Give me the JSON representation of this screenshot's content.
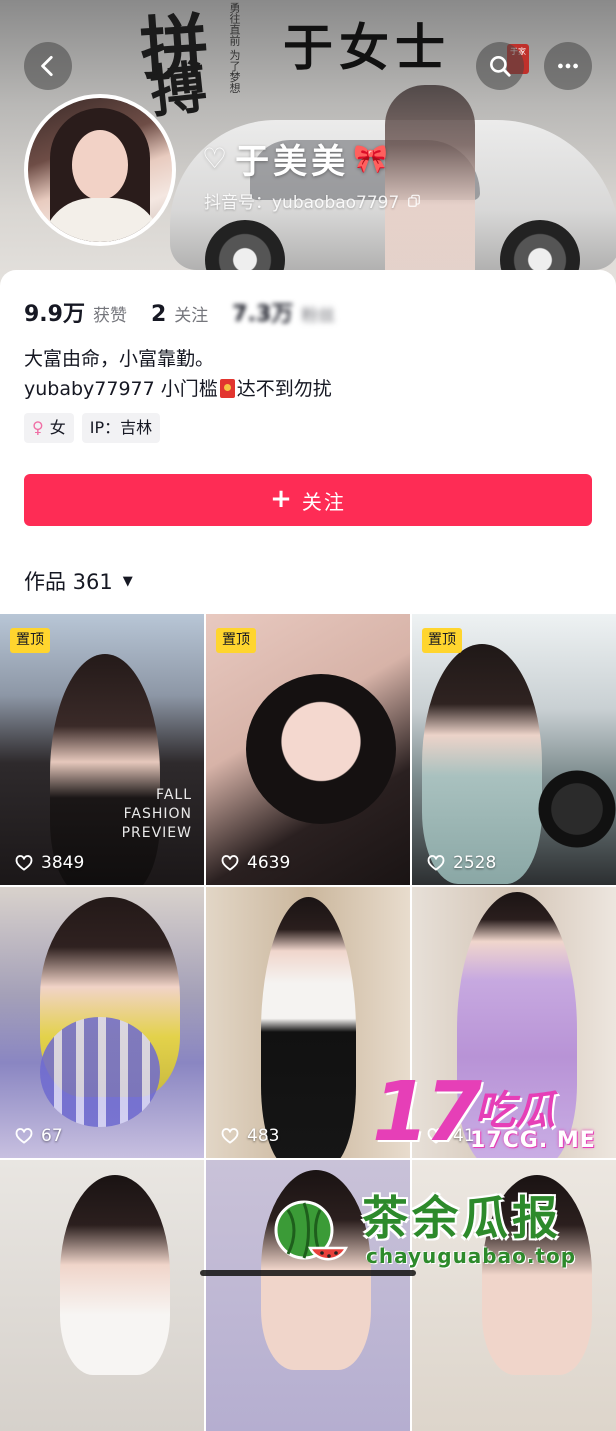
{
  "cover": {
    "title": "于女士",
    "calligraphy_1": "拼",
    "calligraphy_2": "搏",
    "vertical_text": "勇往直前 为了梦想",
    "seal": "于家"
  },
  "header": {
    "back_icon": "chevron-left-icon",
    "search_icon": "search-icon",
    "more_icon": "more-dots-icon"
  },
  "profile": {
    "nickname": "于美美",
    "nickname_prefix": "♡",
    "nickname_suffix": "🎀",
    "douyin_id": "抖音号：yubaobao7797"
  },
  "stats": [
    {
      "num": "9.9万",
      "label": "获赞"
    },
    {
      "num": "2",
      "label": "关注"
    },
    {
      "num": "7.3万",
      "label": "粉丝"
    }
  ],
  "bio": {
    "line1": "大富由命，小富靠勤。",
    "line2_a": "yubaby77977 小门槛",
    "line2_b": "达不到勿扰"
  },
  "tags": {
    "gender_icon": "♀",
    "gender": "女",
    "ip": "IP：吉林"
  },
  "follow": {
    "plus": "+",
    "label": "关注"
  },
  "works": {
    "label": "作品 361",
    "caret": "▼"
  },
  "grid": [
    {
      "pinned": true,
      "pin_label": "置顶",
      "likes": "3849",
      "overlay": "FALL\nFASHION\nPREVIEW"
    },
    {
      "pinned": true,
      "pin_label": "置顶",
      "likes": "4639"
    },
    {
      "pinned": true,
      "pin_label": "置顶",
      "likes": "2528"
    },
    {
      "pinned": false,
      "likes": "67"
    },
    {
      "pinned": false,
      "likes": "483"
    },
    {
      "pinned": false,
      "likes": "41"
    },
    {
      "pinned": false
    },
    {
      "pinned": false
    },
    {
      "pinned": false
    }
  ],
  "watermarks": {
    "num": "17",
    "cn": "吃瓜",
    "url1": "17CG. ME",
    "tea": "茶余瓜报",
    "url2": "chayuguabao.top"
  },
  "colors": {
    "accent": "#fe2c55",
    "pin": "#ffd52e",
    "watermark_pink": "#e63fb7",
    "watermark_green": "#2d8a2b"
  }
}
